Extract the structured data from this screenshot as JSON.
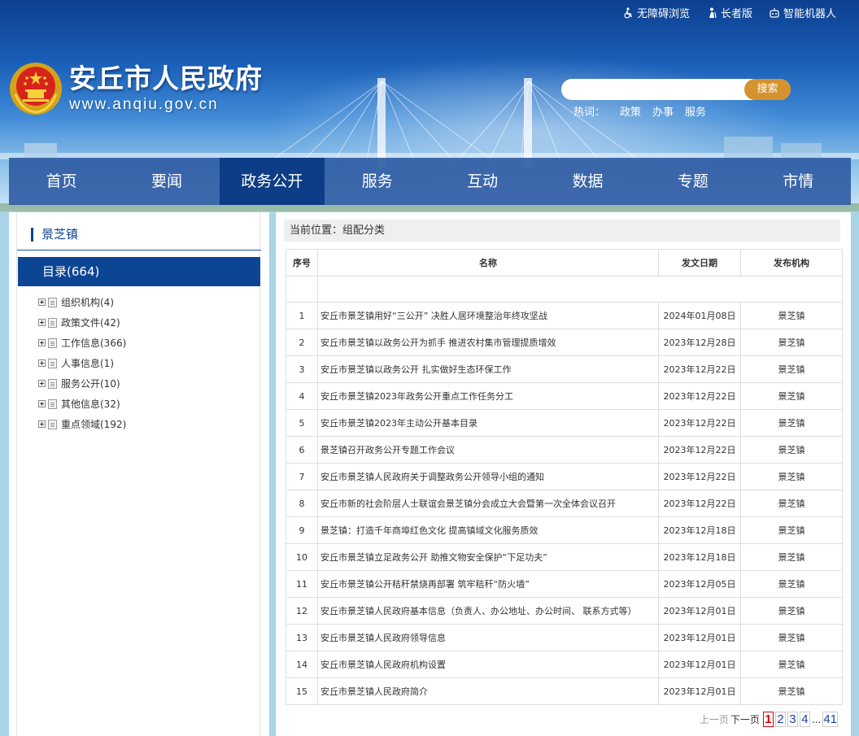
{
  "topbar": {
    "accessible": "无障碍浏览",
    "elder": "长者版",
    "robot": "智能机器人"
  },
  "site": {
    "title": "安丘市人民政府",
    "url": "www.anqiu.gov.cn"
  },
  "search": {
    "placeholder": "",
    "button": "搜索",
    "hot_label": "热词：",
    "hot_words": [
      "政策",
      "办事",
      "服务"
    ]
  },
  "nav": [
    "首页",
    "要闻",
    "政务公开",
    "服务",
    "互动",
    "数据",
    "专题",
    "市情"
  ],
  "sidebar": {
    "title": "景芝镇",
    "category": "目录(664)",
    "tree": [
      "组织机构(4)",
      "政策文件(42)",
      "工作信息(366)",
      "人事信息(1)",
      "服务公开(10)",
      "其他信息(32)",
      "重点领域(192)"
    ]
  },
  "breadcrumb": "当前位置：组配分类",
  "table": {
    "headers": [
      "序号",
      "名称",
      "发文日期",
      "发布机构"
    ],
    "rows": [
      {
        "no": "1",
        "name": "安丘市景芝镇用好“三公开” 决胜人居环境整治年终攻坚战",
        "date": "2024年01月08日",
        "org": "景芝镇"
      },
      {
        "no": "2",
        "name": "安丘市景芝镇以政务公开为抓手 推进农村集市管理提质增效",
        "date": "2023年12月28日",
        "org": "景芝镇"
      },
      {
        "no": "3",
        "name": "安丘市景芝镇以政务公开 扎实做好生态环保工作",
        "date": "2023年12月22日",
        "org": "景芝镇"
      },
      {
        "no": "4",
        "name": "安丘市景芝镇2023年政务公开重点工作任务分工",
        "date": "2023年12月22日",
        "org": "景芝镇"
      },
      {
        "no": "5",
        "name": "安丘市景芝镇2023年主动公开基本目录",
        "date": "2023年12月22日",
        "org": "景芝镇"
      },
      {
        "no": "6",
        "name": "景芝镇召开政务公开专题工作会议",
        "date": "2023年12月22日",
        "org": "景芝镇"
      },
      {
        "no": "7",
        "name": "安丘市景芝镇人民政府关于调整政务公开领导小组的通知",
        "date": "2023年12月22日",
        "org": "景芝镇"
      },
      {
        "no": "8",
        "name": "安丘市新的社会阶层人士联谊会景芝镇分会成立大会暨第一次全体会议召开",
        "date": "2023年12月22日",
        "org": "景芝镇"
      },
      {
        "no": "9",
        "name": "景芝镇：打造千年商埠红色文化 提高镇域文化服务质效",
        "date": "2023年12月18日",
        "org": "景芝镇"
      },
      {
        "no": "10",
        "name": "安丘市景芝镇立足政务公开 助推文物安全保护“下足功夫”",
        "date": "2023年12月18日",
        "org": "景芝镇"
      },
      {
        "no": "11",
        "name": "安丘市景芝镇公开秸秆禁烧再部署 筑牢秸秆“防火墙”",
        "date": "2023年12月05日",
        "org": "景芝镇"
      },
      {
        "no": "12",
        "name": "安丘市景芝镇人民政府基本信息（负责人、办公地址、办公时间、 联系方式等）",
        "date": "2023年12月01日",
        "org": "景芝镇"
      },
      {
        "no": "13",
        "name": "安丘市景芝镇人民政府领导信息",
        "date": "2023年12月01日",
        "org": "景芝镇"
      },
      {
        "no": "14",
        "name": "安丘市景芝镇人民政府机构设置",
        "date": "2023年12月01日",
        "org": "景芝镇"
      },
      {
        "no": "15",
        "name": "安丘市景芝镇人民政府简介",
        "date": "2023年12月01日",
        "org": "景芝镇"
      }
    ]
  },
  "pager": {
    "prev": "上一页",
    "next": "下一页",
    "pages": [
      "1",
      "2",
      "3",
      "4"
    ],
    "ellipsis": "...",
    "last": "41",
    "current": "1"
  }
}
